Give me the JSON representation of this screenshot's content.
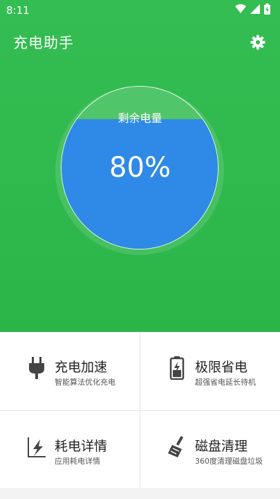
{
  "status": {
    "time": "8:11"
  },
  "app": {
    "title": "充电助手"
  },
  "battery": {
    "label": "剩余电量",
    "value_text": "80%",
    "level": 0.8,
    "fill_color": "#2e8ae6"
  },
  "colors": {
    "primary_green": "#2fb94d"
  },
  "features": [
    {
      "title": "充电加速",
      "subtitle": "智能算法优化充电",
      "icon": "plug-icon"
    },
    {
      "title": "极限省电",
      "subtitle": "超强省电延长待机",
      "icon": "battery-saver-icon"
    },
    {
      "title": "耗电详情",
      "subtitle": "应用耗电详情",
      "icon": "power-chart-icon"
    },
    {
      "title": "磁盘清理",
      "subtitle": "360度清理磁盘垃圾",
      "icon": "broom-icon"
    }
  ]
}
